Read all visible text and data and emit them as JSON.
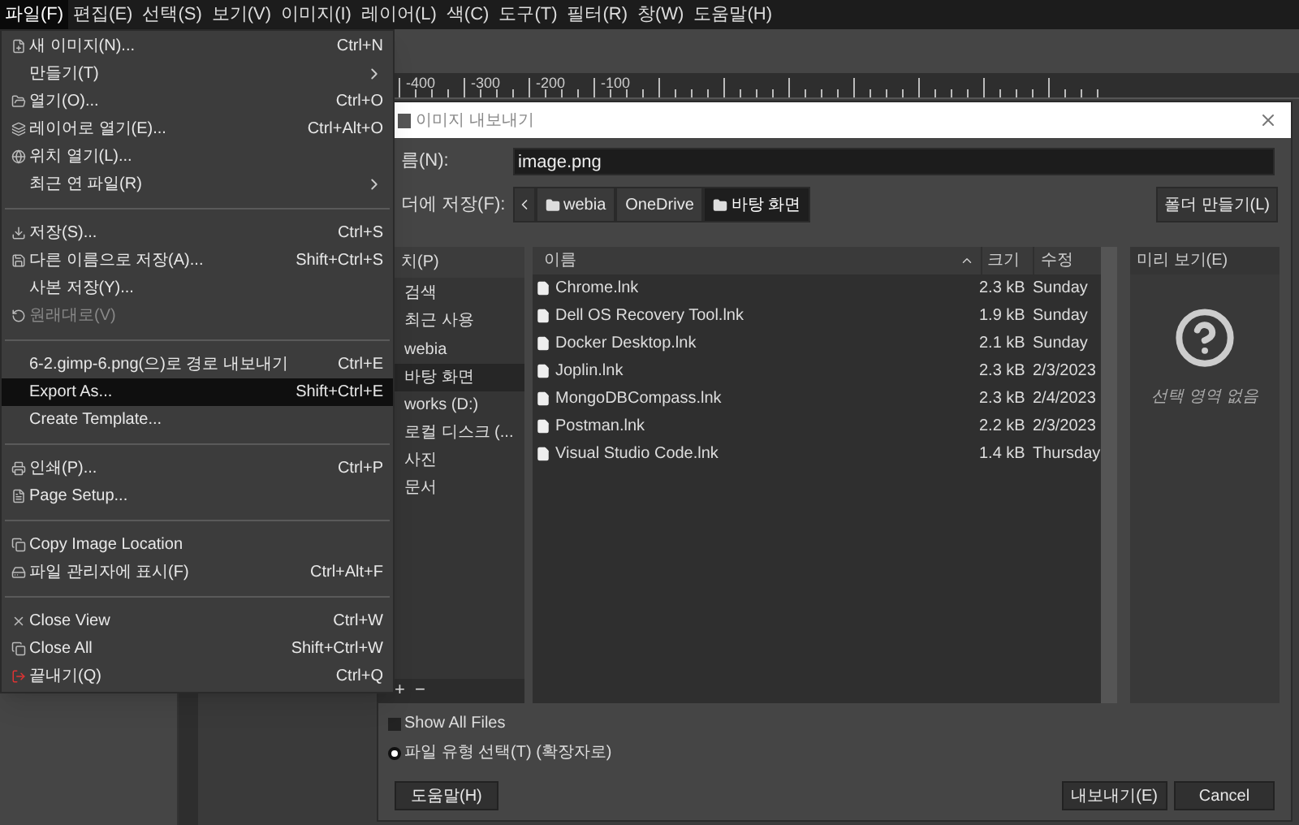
{
  "menubar": [
    {
      "label": "파일(F)",
      "selected": true
    },
    {
      "label": "편집(E)",
      "selected": false
    },
    {
      "label": "선택(S)",
      "selected": false
    },
    {
      "label": "보기(V)",
      "selected": false
    },
    {
      "label": "이미지(I)",
      "selected": false
    },
    {
      "label": "레이어(L)",
      "selected": false
    },
    {
      "label": "색(C)",
      "selected": false
    },
    {
      "label": "도구(T)",
      "selected": false
    },
    {
      "label": "필터(R)",
      "selected": false
    },
    {
      "label": "창(W)",
      "selected": false
    },
    {
      "label": "도움말(H)",
      "selected": false
    }
  ],
  "ruler": {
    "labels": [
      "-400",
      "-300",
      "-200",
      "-100"
    ]
  },
  "file_menu": {
    "items": [
      {
        "kind": "item",
        "label": "새 이미지(N)...",
        "shortcut": "Ctrl+N",
        "submenu": false,
        "disabled": false,
        "selected": false
      },
      {
        "kind": "item",
        "label": "만들기(T)",
        "submenu": true,
        "disabled": false,
        "selected": false
      },
      {
        "kind": "item",
        "label": "열기(O)...",
        "shortcut": "Ctrl+O",
        "submenu": false,
        "disabled": false,
        "selected": false
      },
      {
        "kind": "item",
        "label": "레이어로 열기(E)...",
        "shortcut": "Ctrl+Alt+O",
        "submenu": false,
        "disabled": false,
        "selected": false
      },
      {
        "kind": "item",
        "label": "위치 열기(L)...",
        "submenu": false,
        "disabled": false,
        "selected": false
      },
      {
        "kind": "item",
        "label": "최근 연 파일(R)",
        "submenu": true,
        "disabled": false,
        "selected": false
      },
      {
        "kind": "separator"
      },
      {
        "kind": "item",
        "label": "저장(S)...",
        "shortcut": "Ctrl+S",
        "submenu": false,
        "disabled": false,
        "selected": false
      },
      {
        "kind": "item",
        "label": "다른 이름으로 저장(A)...",
        "shortcut": "Shift+Ctrl+S",
        "submenu": false,
        "disabled": false,
        "selected": false
      },
      {
        "kind": "item",
        "label": "사본 저장(Y)...",
        "submenu": false,
        "disabled": false,
        "selected": false
      },
      {
        "kind": "item",
        "label": "원래대로(V)",
        "submenu": false,
        "disabled": true,
        "selected": false
      },
      {
        "kind": "separator"
      },
      {
        "kind": "item",
        "label": "6-2.gimp-6.png(으)로 경로 내보내기",
        "shortcut": "Ctrl+E",
        "submenu": false,
        "disabled": false,
        "selected": false
      },
      {
        "kind": "item",
        "label": "Export As...",
        "shortcut": "Shift+Ctrl+E",
        "submenu": false,
        "disabled": false,
        "selected": true
      },
      {
        "kind": "item",
        "label": "Create Template...",
        "submenu": false,
        "disabled": false,
        "selected": false
      },
      {
        "kind": "separator"
      },
      {
        "kind": "item",
        "label": "인쇄(P)...",
        "shortcut": "Ctrl+P",
        "submenu": false,
        "disabled": false,
        "selected": false
      },
      {
        "kind": "item",
        "label": "Page Setup...",
        "submenu": false,
        "disabled": false,
        "selected": false
      },
      {
        "kind": "separator"
      },
      {
        "kind": "item",
        "label": "Copy Image Location",
        "submenu": false,
        "disabled": false,
        "selected": false
      },
      {
        "kind": "item",
        "label": "파일 관리자에 표시(F)",
        "shortcut": "Ctrl+Alt+F",
        "submenu": false,
        "disabled": false,
        "selected": false
      },
      {
        "kind": "separator"
      },
      {
        "kind": "item",
        "label": "Close View",
        "shortcut": "Ctrl+W",
        "submenu": false,
        "disabled": false,
        "selected": false
      },
      {
        "kind": "item",
        "label": "Close All",
        "shortcut": "Shift+Ctrl+W",
        "submenu": false,
        "disabled": false,
        "selected": false
      },
      {
        "kind": "item",
        "label": "끝내기(Q)",
        "shortcut": "Ctrl+Q",
        "submenu": false,
        "disabled": false,
        "selected": false
      }
    ]
  },
  "dialog": {
    "title": "이미지 내보내기",
    "name_label": "름(N):",
    "name_value": "image.png",
    "folder_label": "더에 저장(F):",
    "breadcrumb": [
      {
        "label": "webia",
        "folder": true,
        "selected": false
      },
      {
        "label": "OneDrive",
        "folder": false,
        "selected": false
      },
      {
        "label": "바탕 화면",
        "folder": true,
        "selected": true
      }
    ],
    "create_folder_button": "폴더 만들기(L)",
    "places": {
      "header": "치(P)",
      "items": [
        {
          "label": "검색",
          "selected": false
        },
        {
          "label": "최근 사용",
          "selected": false
        },
        {
          "label": "webia",
          "selected": false
        },
        {
          "label": "바탕 화면",
          "selected": true
        },
        {
          "label": "works (D:)",
          "selected": false
        },
        {
          "label": "로컬 디스크 (...",
          "selected": false
        },
        {
          "label": "사진",
          "selected": false
        },
        {
          "label": "문서",
          "selected": false
        }
      ],
      "add_button": "+",
      "remove_button": "−"
    },
    "files": {
      "columns": [
        "이름",
        "크기",
        "수정"
      ],
      "rows": [
        {
          "name": "Chrome.lnk",
          "size": "2.3 kB",
          "modified": "Sunday",
          "selected": false
        },
        {
          "name": "Dell OS Recovery Tool.lnk",
          "size": "1.9 kB",
          "modified": "Sunday",
          "selected": false
        },
        {
          "name": "Docker Desktop.lnk",
          "size": "2.1 kB",
          "modified": "Sunday",
          "selected": false
        },
        {
          "name": "Joplin.lnk",
          "size": "2.3 kB",
          "modified": "2/3/2023",
          "selected": false
        },
        {
          "name": "MongoDBCompass.lnk",
          "size": "2.3 kB",
          "modified": "2/4/2023",
          "selected": false
        },
        {
          "name": "Postman.lnk",
          "size": "2.2 kB",
          "modified": "2/3/2023",
          "selected": false
        },
        {
          "name": "Visual Studio Code.lnk",
          "size": "1.4 kB",
          "modified": "Thursday",
          "selected": false
        }
      ]
    },
    "preview": {
      "header": "미리 보기(E)",
      "message": "선택 영역 없음"
    },
    "show_all_files": {
      "label": "Show All Files",
      "checked": false
    },
    "file_type": {
      "label": "파일 유형 선택(T) (확장자로)",
      "expanded": false
    },
    "buttons": {
      "help": "도움말(H)",
      "export": "내보내기(E)",
      "cancel": "Cancel"
    }
  }
}
